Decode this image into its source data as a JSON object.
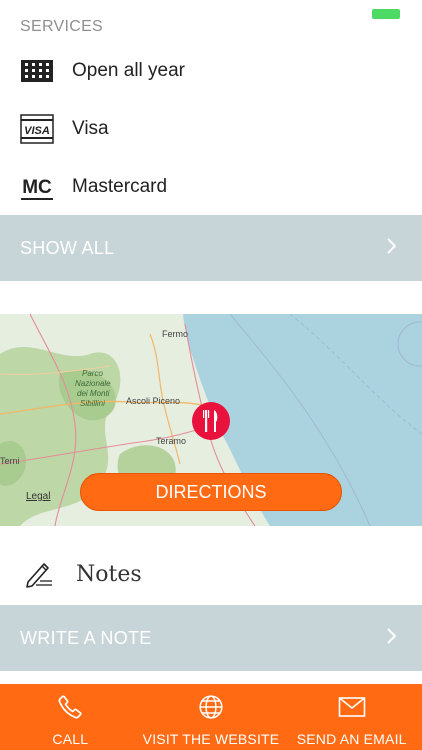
{
  "services": {
    "title": "SERVICES",
    "items": [
      {
        "label": "Open all year",
        "icon": "calendar-grid-icon"
      },
      {
        "label": "Visa",
        "icon": "visa-card-icon"
      },
      {
        "label": "Mastercard",
        "icon": "mastercard-icon"
      }
    ],
    "show_all": "SHOW ALL"
  },
  "map": {
    "places": {
      "fermo": "Fermo",
      "parco": "Parco",
      "nazionale": "Nazionale",
      "dei_monti": "dei Monti",
      "sibillini": "Sibillini",
      "ascoli": "Ascoli Piceno",
      "teramo": "Teramo",
      "terni": "Terni"
    },
    "legal": "Legal",
    "marker_icon": "restaurant-icon",
    "directions_label": "DIRECTIONS"
  },
  "notes": {
    "title": "Notes",
    "write_label": "WRITE A NOTE"
  },
  "bottom_bar": {
    "call": "CALL",
    "website": "VISIT THE WEBSITE",
    "email": "SEND AN EMAIL"
  },
  "colors": {
    "accent": "#ff6a13",
    "bar_gray": "#c8d5d8",
    "marker_red": "#e8123c"
  }
}
